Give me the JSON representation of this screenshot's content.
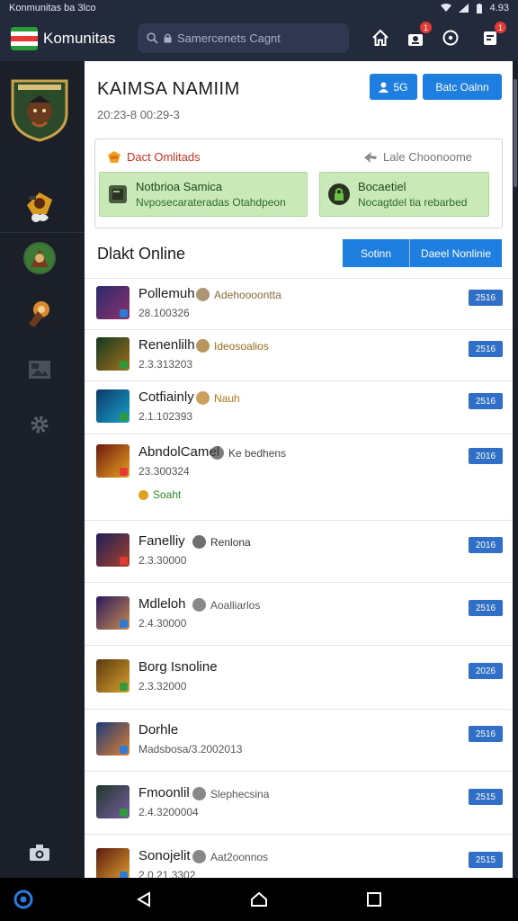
{
  "status_bar": {
    "left_text": "Konmunitas ba 3lco",
    "time": "4.93"
  },
  "app_bar": {
    "title": "Komunitas",
    "search_placeholder": "Samercenets Cagnt",
    "notif_badge_1": "1",
    "notif_badge_2": "1",
    "logo_colors": [
      "#2a9d3a",
      "#ffffff",
      "#e53935",
      "#ffffff",
      "#2a9d3a"
    ]
  },
  "profile": {
    "name": "KAIMSA NAMIIM",
    "date": "20:23-8 00:29-3",
    "follow_count": "5G",
    "action_label": "Batc Oalnn"
  },
  "panel": {
    "left_title": "Dact Omlitads",
    "right_title": "Lale Choonoome",
    "left_card_title": "Notbrioa Samica",
    "left_card_sub": "Nvposecarateradas Otahdpeon",
    "right_card_title": "Bocaetiel",
    "right_card_sub": "Nocagtdel tia rebarbed"
  },
  "section": {
    "title": "Dlakt Online",
    "seg_left": "Sotinn",
    "seg_right": "Daeel Nonlinie"
  },
  "rows": [
    {
      "name": "Pollemuh",
      "date": "28.100326",
      "meta": "Adehoooontta",
      "meta_color": "#8a6a3a",
      "badge": "2516",
      "thumb_a": "#2b2c6e",
      "thumb_b": "#8e2f6a",
      "dot": "#2e7bd6"
    },
    {
      "name": "Renenlilh",
      "date": "2.3.313203",
      "meta": "Ideosoalios",
      "meta_color": "#9a6a1a",
      "badge": "2516",
      "thumb_a": "#123a1f",
      "thumb_b": "#a36f1e",
      "dot": "#2e9a3a"
    },
    {
      "name": "Cotfiainly",
      "date": "2.1.102393",
      "meta": "Nauh",
      "meta_color": "#b3771a",
      "badge": "2516",
      "thumb_a": "#0b3a6a",
      "thumb_b": "#1aa0c8",
      "dot": "#2e9a3a"
    },
    {
      "name": "AbndolCamel",
      "date": "23.300324",
      "meta": "Ke bedhens",
      "meta_color": "#444444",
      "badge": "2016",
      "thumb_a": "#6e1a0e",
      "thumb_b": "#e8a020",
      "dot": "#e53935",
      "extra": "Soaht"
    },
    {
      "name": "Fanelliy",
      "date": "2.3.30000",
      "meta": "Renlona",
      "meta_color": "#333333",
      "badge": "2016",
      "thumb_a": "#1e1e5a",
      "thumb_b": "#a3432a",
      "dot": "#e53935"
    },
    {
      "name": "Mdleloh",
      "date": "2.4.30000",
      "meta": "Aoalliarlos",
      "meta_color": "#555555",
      "badge": "2516",
      "thumb_a": "#2a1a5e",
      "thumb_b": "#c88a50",
      "dot": "#2e7bd6"
    },
    {
      "name": "Borg Isnoline",
      "date": "2.3.32000",
      "meta": "",
      "meta_color": "#555555",
      "badge": "2026",
      "thumb_a": "#5a3a0e",
      "thumb_b": "#d8a030",
      "dot": "#2e9a3a"
    },
    {
      "name": "Dorhle",
      "date": "Madsbosa/3.2002013",
      "meta": "",
      "meta_color": "#555555",
      "badge": "2516",
      "thumb_a": "#1a3a7a",
      "thumb_b": "#e08030",
      "dot": "#2e7bd6"
    },
    {
      "name": "Fmoonlil",
      "date": "2.4.3200004",
      "meta": "Slephecsina",
      "meta_color": "#555555",
      "badge": "2515",
      "thumb_a": "#1e3a2a",
      "thumb_b": "#7a5aa0",
      "dot": "#2e9a3a"
    },
    {
      "name": "Sonojelit",
      "date": "2.0.21.3302",
      "meta": "Aat2oonnos",
      "meta_color": "#555555",
      "badge": "2515",
      "thumb_a": "#5a1a0e",
      "thumb_b": "#e0a030",
      "dot": "#2e7bd6"
    }
  ],
  "colors": {
    "accent": "#1f7fe0",
    "appbar": "#232a3c",
    "sidebar": "#1b1f27",
    "badge": "#2f6fc7",
    "green_card": "#c9e9b9"
  },
  "icons": [
    "search-icon",
    "lock-icon",
    "home-icon",
    "profile-notification-icon",
    "compass-icon",
    "notifications-icon",
    "camera-icon",
    "settings-icon",
    "back-icon",
    "home-nav-icon",
    "recents-icon"
  ]
}
